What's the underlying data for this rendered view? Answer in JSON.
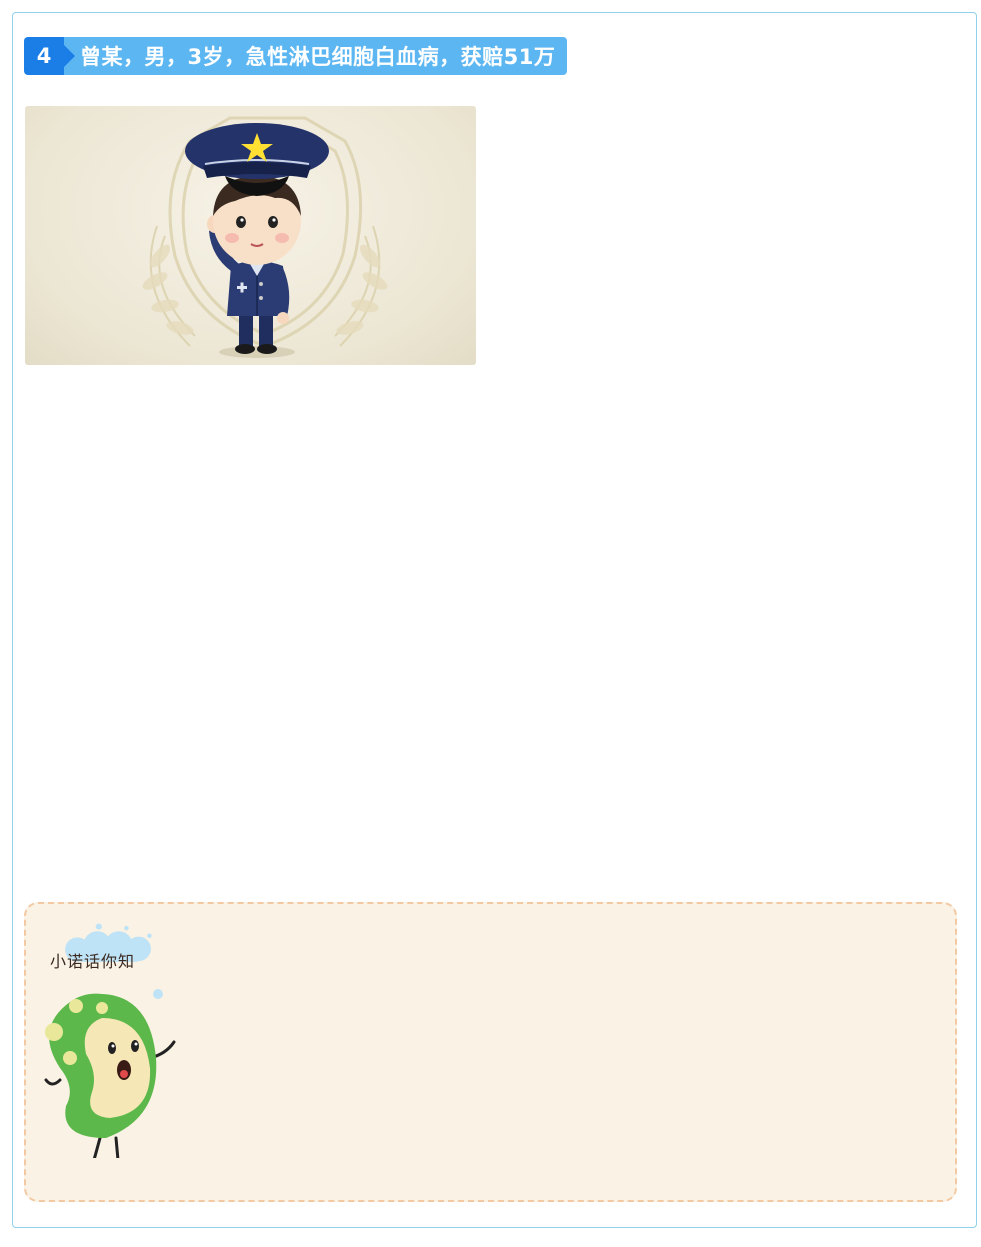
{
  "section": {
    "number": "4",
    "title": "曾某，男，3岁，急性淋巴细胞白血病，获赔51万"
  },
  "tip": {
    "bubble_label": "小诺话你知"
  }
}
